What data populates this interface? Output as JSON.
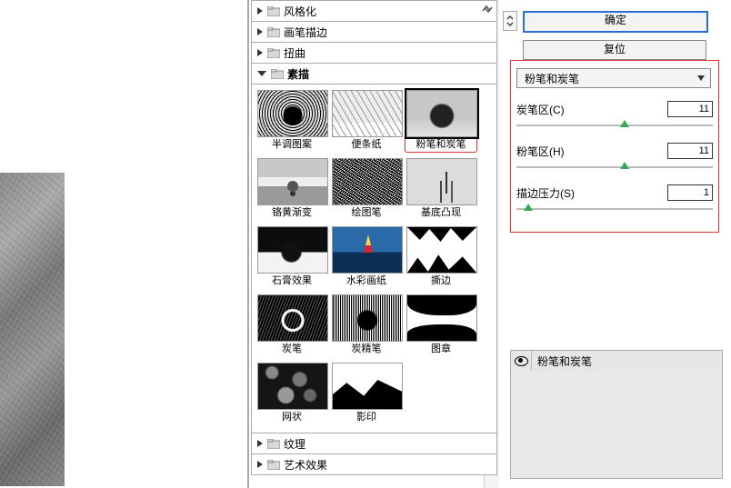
{
  "categories": {
    "c0": "风格化",
    "c1": "画笔描边",
    "c2": "扭曲",
    "c3": "素描",
    "c4": "纹理",
    "c5": "艺术效果"
  },
  "thumbs": {
    "r0c0": "半调图案",
    "r0c1": "便条纸",
    "r0c2": "粉笔和炭笔",
    "r1c0": "铬黄渐变",
    "r1c1": "绘图笔",
    "r1c2": "基底凸现",
    "r2c0": "石膏效果",
    "r2c1": "水彩画纸",
    "r2c2": "撕边",
    "r3c0": "炭笔",
    "r3c1": "炭精笔",
    "r3c2": "图章",
    "r4c0": "网状",
    "r4c1": "影印"
  },
  "buttons": {
    "ok": "确定",
    "reset": "复位"
  },
  "dd": {
    "value": "粉笔和炭笔"
  },
  "params": {
    "p0": {
      "label": "炭笔区(C)",
      "value": "11",
      "pct": 55
    },
    "p1": {
      "label": "粉笔区(H)",
      "value": "11",
      "pct": 55
    },
    "p2": {
      "label": "描边压力(S)",
      "value": "1",
      "pct": 6
    }
  },
  "layers": {
    "name": "粉笔和炭笔"
  },
  "chart_data": {
    "type": "table",
    "title": "Chalk & Charcoal filter parameters",
    "rows": [
      {
        "param": "炭笔区(C)",
        "value": 11
      },
      {
        "param": "粉笔区(H)",
        "value": 11
      },
      {
        "param": "描边压力(S)",
        "value": 1
      }
    ]
  }
}
